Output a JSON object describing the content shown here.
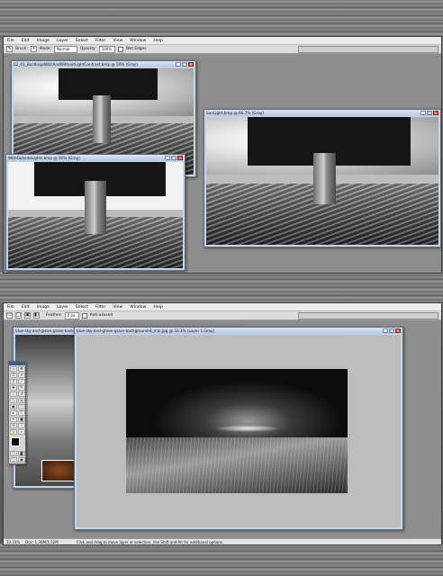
{
  "menu": [
    "File",
    "Edit",
    "Image",
    "Layer",
    "Select",
    "Filter",
    "View",
    "Window",
    "Help"
  ],
  "top": {
    "options": {
      "mode_label": "Mode:",
      "mode_value": "Normal",
      "opacity_label": "Opacity:",
      "opacity_value": "100%",
      "wet_edges_label": "Wet Edges",
      "brush_label": "Brush:"
    },
    "windows": [
      {
        "title": "02_01_BuildingsWithAndWithoutLightContrast.bmp @ 50% (Gray)"
      },
      {
        "title": "WithOutsideLights.bmp @ 50% (Gray)"
      },
      {
        "title": "SunLight.bmp @ 66.7% (Gray)"
      }
    ]
  },
  "bottom": {
    "options": {
      "feather_label": "Feather:",
      "feather_value": "0 px",
      "antialiased_label": "Anti-aliased"
    },
    "back_window_title": "blue-sky-and-green-grass-backgr...",
    "main_window_title": "blue-sky-and-green-grass-background-8_mai.jpg @ 33.3% (Layer 1,Gray)",
    "status": {
      "zoom": "33.33%",
      "doc": "Doc: 1.36M/1.32M",
      "hint": "Click and drag to move layer or selection. Use Shift and Alt for additional options."
    }
  },
  "icons": [
    "brush-icon",
    "marquee-icon",
    "move-icon",
    "lasso-icon",
    "crop-icon"
  ],
  "colors": {
    "title_bar": "#c9d5e6",
    "workspace": "#8e8e8e",
    "menubar": "#ececec"
  }
}
